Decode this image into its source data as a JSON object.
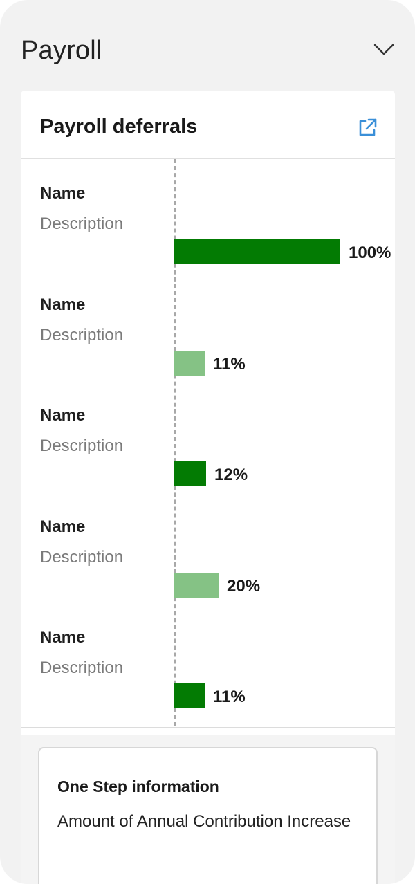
{
  "section": {
    "title": "Payroll",
    "toggle_icon": "chevron-down-icon"
  },
  "card": {
    "title": "Payroll deferrals",
    "action_icon": "external-link-icon"
  },
  "colors": {
    "bar_dark": "#037b03",
    "bar_light": "#85c285",
    "link_blue": "#3a8fd8"
  },
  "rows": [
    {
      "name": "Name",
      "description": "Description",
      "value_label": "100%",
      "value": 100,
      "shade": "dark"
    },
    {
      "name": "Name",
      "description": "Description",
      "value_label": "11%",
      "value": 11,
      "shade": "light"
    },
    {
      "name": "Name",
      "description": "Description",
      "value_label": "12%",
      "value": 12,
      "shade": "dark"
    },
    {
      "name": "Name",
      "description": "Description",
      "value_label": "20%",
      "value": 20,
      "shade": "light"
    },
    {
      "name": "Name",
      "description": "Description",
      "value_label": "11%",
      "value": 11,
      "shade": "dark"
    }
  ],
  "info": {
    "title": "One Step information",
    "text": "Amount of Annual Contribution Increase"
  }
}
